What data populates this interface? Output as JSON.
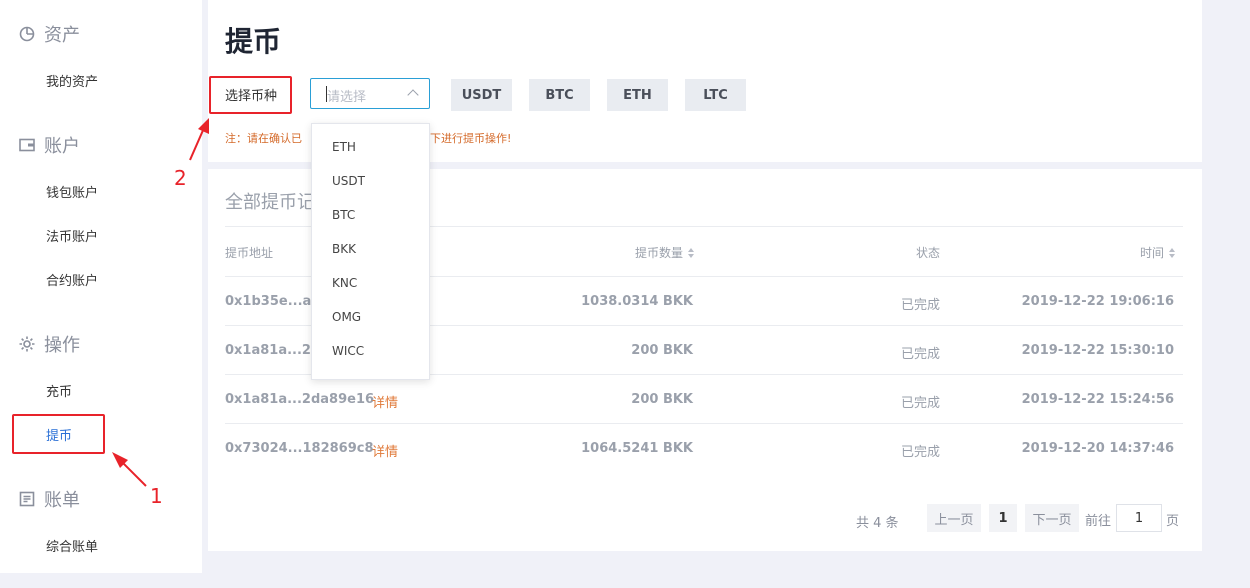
{
  "sidebar": {
    "sections": [
      {
        "title": "资产",
        "icon": "pie-chart-icon",
        "items": [
          "我的资产"
        ]
      },
      {
        "title": "账户",
        "icon": "wallet-icon",
        "items": [
          "钱包账户",
          "法币账户",
          "合约账户"
        ]
      },
      {
        "title": "操作",
        "icon": "gear-icon",
        "items": [
          "充币",
          "提币"
        ]
      },
      {
        "title": "账单",
        "icon": "bill-icon",
        "items": [
          "综合账单"
        ]
      }
    ],
    "active_item": "提币"
  },
  "page": {
    "title": "提币",
    "coin_label": "选择币种",
    "select_placeholder": "请选择",
    "quick_coins": [
      "USDT",
      "BTC",
      "ETH",
      "LTC"
    ],
    "note_start": "注：请在确认已",
    "note_end": "下进行提币操作!"
  },
  "dropdown": {
    "options": [
      "ETH",
      "USDT",
      "BTC",
      "BKK",
      "KNC",
      "OMG",
      "WICC"
    ]
  },
  "records": {
    "title": "全部提币记",
    "headers": {
      "address": "提币地址",
      "amount": "提币数量",
      "status": "状态",
      "time": "时间"
    },
    "rows": [
      {
        "address": "0x1b35e...a16",
        "detail": "",
        "amount": "1038.0314 BKK",
        "status": "已完成",
        "time": "2019-12-22 19:06:16"
      },
      {
        "address": "0x1a81a...2da",
        "detail": "",
        "amount": "200 BKK",
        "status": "已完成",
        "time": "2019-12-22 15:30:10"
      },
      {
        "address": "0x1a81a...2da89e16",
        "detail": "详情",
        "amount": "200 BKK",
        "status": "已完成",
        "time": "2019-12-22 15:24:56"
      },
      {
        "address": "0x73024...182869c8",
        "detail": "详情",
        "amount": "1064.5241 BKK",
        "status": "已完成",
        "time": "2019-12-20 14:37:46"
      }
    ]
  },
  "pagination": {
    "total": "共 4 条",
    "prev": "上一页",
    "current": "1",
    "next": "下一页",
    "goto_prefix": "前往",
    "goto_value": "1",
    "goto_suffix": "页"
  },
  "annotations": {
    "label_1": "1",
    "label_2": "2",
    "color": "#e8232a"
  },
  "colors": {
    "accent": "#2a6fd6",
    "detail_link": "#e07a3a",
    "note": "#d46a2a"
  }
}
